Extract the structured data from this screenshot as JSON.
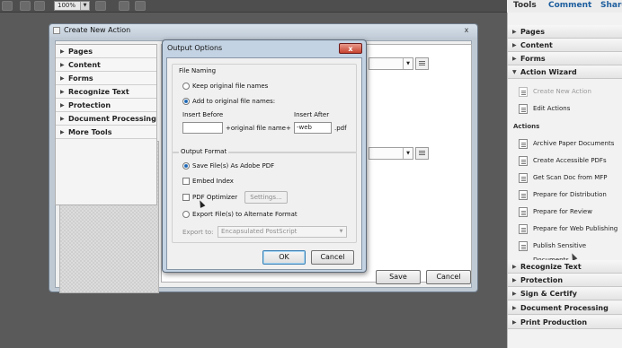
{
  "toolbar": {
    "zoom": "100%",
    "tabs": {
      "tools": "Tools",
      "comment": "Comment",
      "share": "Share"
    }
  },
  "right_panel": {
    "top_sections": [
      "Pages",
      "Content",
      "Forms"
    ],
    "action_wizard": {
      "label": "Action Wizard",
      "items": [
        "Create New Action",
        "Edit Actions"
      ]
    },
    "actions_label": "Actions",
    "actions": [
      "Archive Paper Documents",
      "Create Accessible PDFs",
      "Get Scan Doc from MFP",
      "Prepare for Distribution",
      "Prepare for Review",
      "Prepare for Web Publishing",
      "Publish Sensitive Documents"
    ],
    "bottom_sections": [
      "Recognize Text",
      "Protection",
      "Sign & Certify",
      "Document Processing",
      "Print Production"
    ]
  },
  "create_new_action": {
    "title": "Create New Action",
    "close": "x",
    "categories": [
      "Pages",
      "Content",
      "Forms",
      "Recognize Text",
      "Protection",
      "Document Processing",
      "More Tools"
    ],
    "save": "Save",
    "cancel": "Cancel"
  },
  "output_options": {
    "title": "Output Options",
    "close": "x",
    "file_naming": {
      "label": "File Naming",
      "keep_original": "Keep original file names",
      "add_to_original": "Add to original file names:",
      "insert_before_label": "Insert Before",
      "insert_before_value": "",
      "middle_text": "+original file name+",
      "insert_after_label": "Insert After",
      "insert_after_value": "-web",
      "extension": ".pdf"
    },
    "output_format": {
      "label": "Output Format",
      "save_as_pdf": "Save File(s) As Adobe PDF",
      "embed_index": "Embed Index",
      "pdf_optimizer": "PDF Optimizer",
      "settings": "Settings...",
      "export_alternate": "Export File(s) to Alternate Format",
      "export_to_label": "Export to:",
      "export_to_value": "Encapsulated PostScript"
    },
    "ok": "OK",
    "cancel": "Cancel"
  }
}
